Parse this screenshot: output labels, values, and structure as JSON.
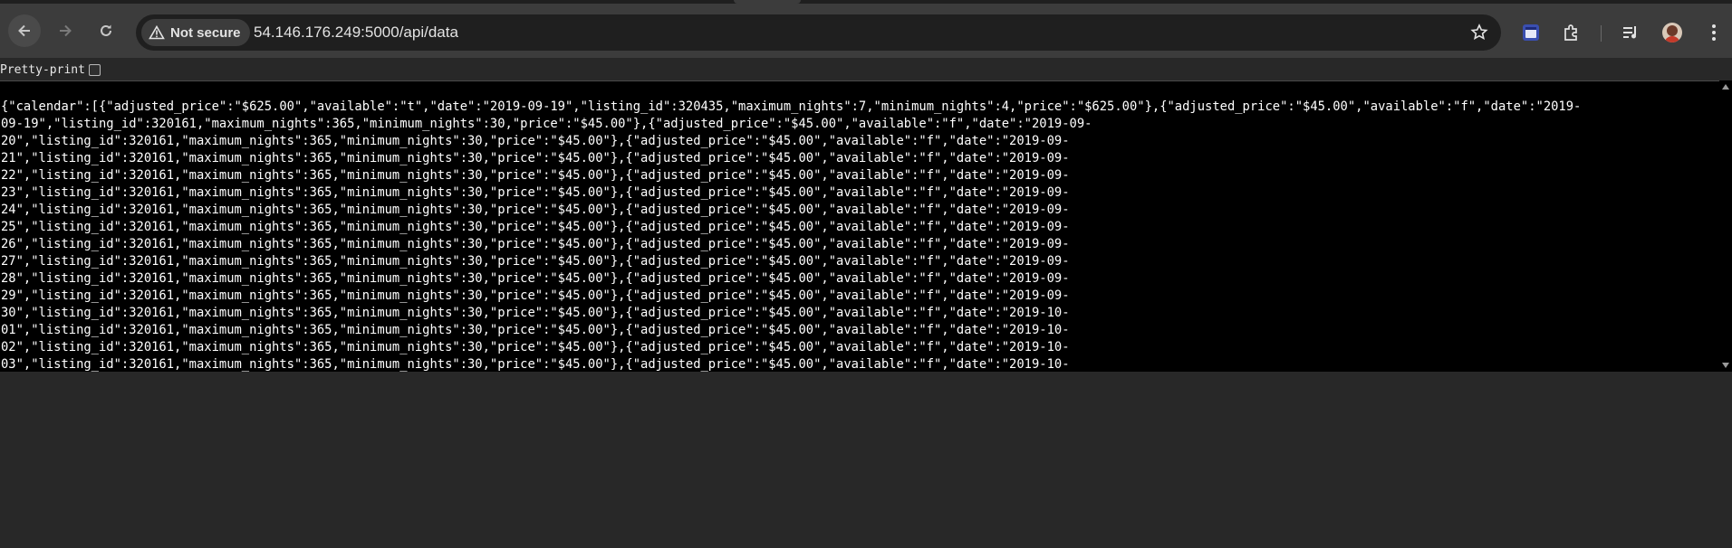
{
  "browser": {
    "security_chip_label": "Not secure",
    "url": "54.146.176.249:5000/api/data",
    "icons": {
      "back": "back-arrow-icon",
      "forward": "forward-arrow-icon",
      "reload": "reload-icon",
      "warning": "warning-icon",
      "bookmark": "star-icon",
      "extension1": "calendar-extension-icon",
      "extension2": "puzzle-extensions-icon",
      "media": "media-controls-icon",
      "menu": "kebab-menu-icon"
    },
    "colors": {
      "toolbar": "#3c3c3c",
      "omnibox": "#1f1f1f",
      "page_bg": "#282828",
      "json_bg": "#000000"
    }
  },
  "page": {
    "pretty_print_label": "Pretty-print",
    "pretty_print_checked": false,
    "json_lines": [
      "{\"calendar\":[{\"adjusted_price\":\"$625.00\",\"available\":\"t\",\"date\":\"2019-09-19\",\"listing_id\":320435,\"maximum_nights\":7,\"minimum_nights\":4,\"price\":\"$625.00\"},{\"adjusted_price\":\"$45.00\",\"available\":\"f\",\"date\":\"2019-",
      "09-19\",\"listing_id\":320161,\"maximum_nights\":365,\"minimum_nights\":30,\"price\":\"$45.00\"},{\"adjusted_price\":\"$45.00\",\"available\":\"f\",\"date\":\"2019-09-",
      "20\",\"listing_id\":320161,\"maximum_nights\":365,\"minimum_nights\":30,\"price\":\"$45.00\"},{\"adjusted_price\":\"$45.00\",\"available\":\"f\",\"date\":\"2019-09-",
      "21\",\"listing_id\":320161,\"maximum_nights\":365,\"minimum_nights\":30,\"price\":\"$45.00\"},{\"adjusted_price\":\"$45.00\",\"available\":\"f\",\"date\":\"2019-09-",
      "22\",\"listing_id\":320161,\"maximum_nights\":365,\"minimum_nights\":30,\"price\":\"$45.00\"},{\"adjusted_price\":\"$45.00\",\"available\":\"f\",\"date\":\"2019-09-",
      "23\",\"listing_id\":320161,\"maximum_nights\":365,\"minimum_nights\":30,\"price\":\"$45.00\"},{\"adjusted_price\":\"$45.00\",\"available\":\"f\",\"date\":\"2019-09-",
      "24\",\"listing_id\":320161,\"maximum_nights\":365,\"minimum_nights\":30,\"price\":\"$45.00\"},{\"adjusted_price\":\"$45.00\",\"available\":\"f\",\"date\":\"2019-09-",
      "25\",\"listing_id\":320161,\"maximum_nights\":365,\"minimum_nights\":30,\"price\":\"$45.00\"},{\"adjusted_price\":\"$45.00\",\"available\":\"f\",\"date\":\"2019-09-",
      "26\",\"listing_id\":320161,\"maximum_nights\":365,\"minimum_nights\":30,\"price\":\"$45.00\"},{\"adjusted_price\":\"$45.00\",\"available\":\"f\",\"date\":\"2019-09-",
      "27\",\"listing_id\":320161,\"maximum_nights\":365,\"minimum_nights\":30,\"price\":\"$45.00\"},{\"adjusted_price\":\"$45.00\",\"available\":\"f\",\"date\":\"2019-09-",
      "28\",\"listing_id\":320161,\"maximum_nights\":365,\"minimum_nights\":30,\"price\":\"$45.00\"},{\"adjusted_price\":\"$45.00\",\"available\":\"f\",\"date\":\"2019-09-",
      "29\",\"listing_id\":320161,\"maximum_nights\":365,\"minimum_nights\":30,\"price\":\"$45.00\"},{\"adjusted_price\":\"$45.00\",\"available\":\"f\",\"date\":\"2019-09-",
      "30\",\"listing_id\":320161,\"maximum_nights\":365,\"minimum_nights\":30,\"price\":\"$45.00\"},{\"adjusted_price\":\"$45.00\",\"available\":\"f\",\"date\":\"2019-10-",
      "01\",\"listing_id\":320161,\"maximum_nights\":365,\"minimum_nights\":30,\"price\":\"$45.00\"},{\"adjusted_price\":\"$45.00\",\"available\":\"f\",\"date\":\"2019-10-",
      "02\",\"listing_id\":320161,\"maximum_nights\":365,\"minimum_nights\":30,\"price\":\"$45.00\"},{\"adjusted_price\":\"$45.00\",\"available\":\"f\",\"date\":\"2019-10-",
      "03\",\"listing_id\":320161,\"maximum_nights\":365,\"minimum_nights\":30,\"price\":\"$45.00\"},{\"adjusted_price\":\"$45.00\",\"available\":\"f\",\"date\":\"2019-10-"
    ]
  }
}
